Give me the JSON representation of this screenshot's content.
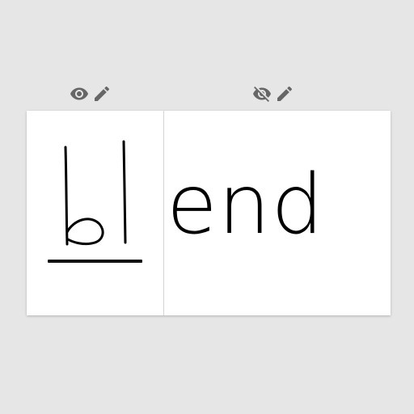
{
  "toolbar_left": {
    "visibility_icon": "eye-icon",
    "edit_icon": "pencil-icon",
    "icon_color": "#666666"
  },
  "toolbar_right": {
    "visibility_icon": "eye-off-icon",
    "edit_icon": "pencil-icon",
    "icon_color": "#666666"
  },
  "canvas": {
    "handwritten_text": "bl",
    "typed_text": "end",
    "background": "#ffffff",
    "ink_color": "#000000"
  }
}
